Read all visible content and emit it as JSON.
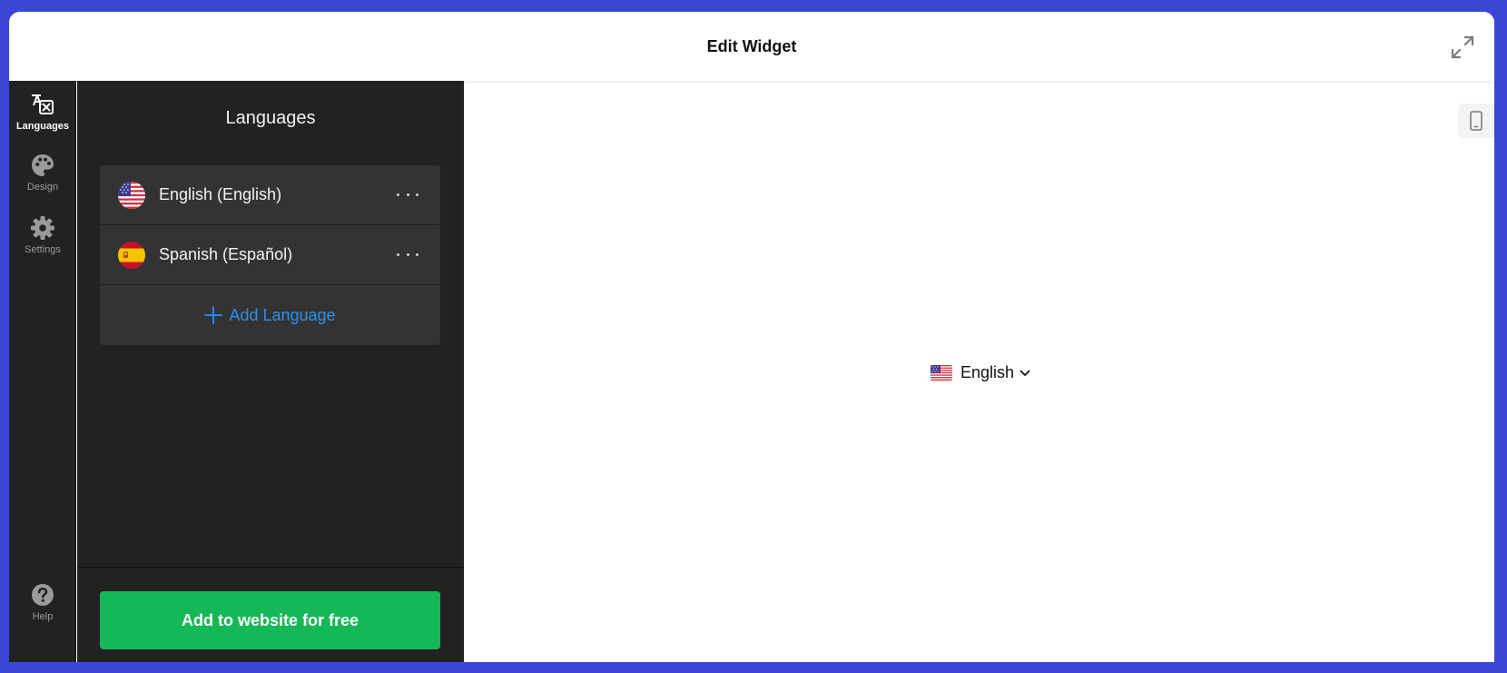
{
  "header": {
    "title": "Edit Widget",
    "expand_icon": "expand-arrows-icon"
  },
  "rail": {
    "items": [
      {
        "label": "Languages",
        "icon": "translate-icon",
        "active": true
      },
      {
        "label": "Design",
        "icon": "palette-icon",
        "active": false
      },
      {
        "label": "Settings",
        "icon": "gear-icon",
        "active": false
      }
    ],
    "help": {
      "label": "Help",
      "icon": "question-circle-icon"
    }
  },
  "panel": {
    "title": "Languages",
    "languages": [
      {
        "name": "English (English)",
        "flag": "us-flag-icon",
        "more_icon": "more-horizontal-icon"
      },
      {
        "name": "Spanish (Español)",
        "flag": "spain-flag-icon",
        "more_icon": "more-horizontal-icon"
      }
    ],
    "add_language_label": "Add Language",
    "cta_label": "Add to website for free"
  },
  "preview": {
    "device_icon": "mobile-phone-icon",
    "selector": {
      "label": "English",
      "flag": "us-flag-icon",
      "icon": "chevron-down-icon"
    }
  },
  "colors": {
    "background": "#3a47d5",
    "sidebar": "#222222",
    "list_item": "#333333",
    "accent_link": "#2d8ff0",
    "cta": "#14b856"
  }
}
